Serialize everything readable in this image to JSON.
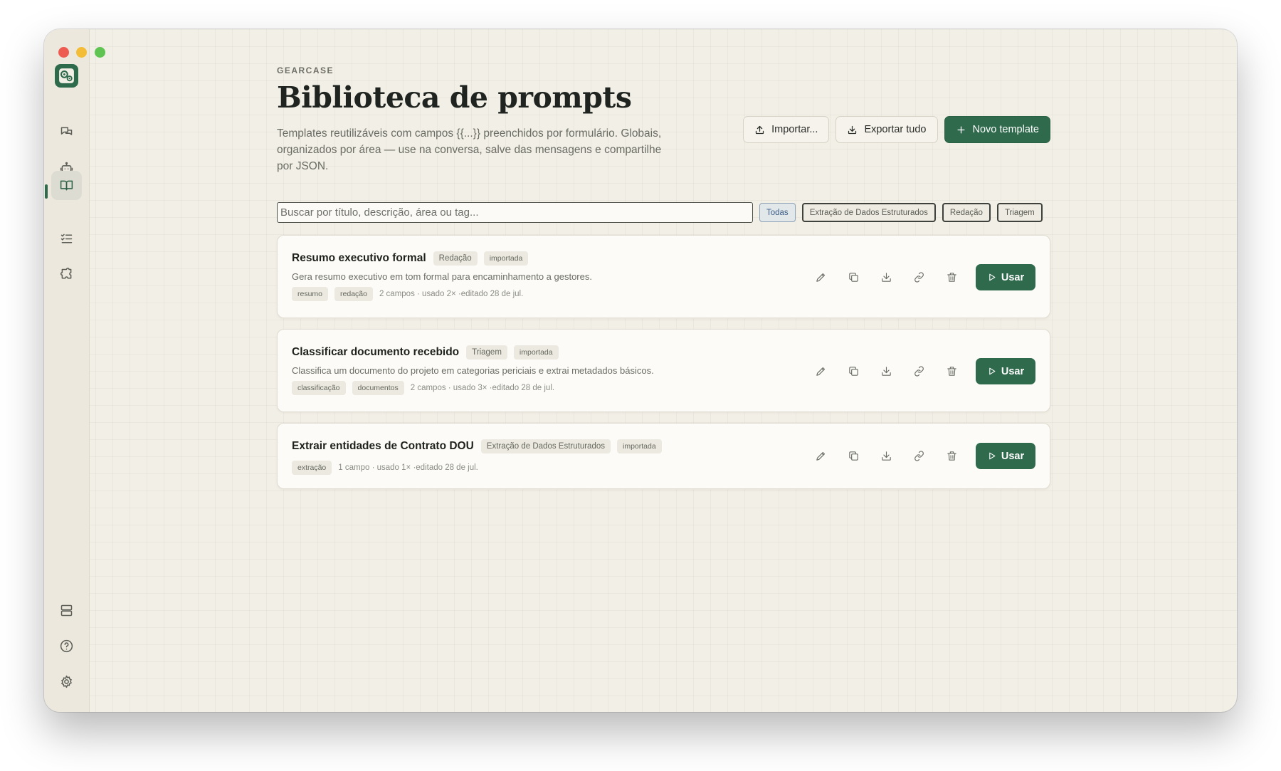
{
  "app": {
    "eyebrow": "GEARCASE",
    "title": "Biblioteca de prompts",
    "subtitle": "Templates reutilizáveis com campos {{...}} preenchidos por formulário. Globais, organizados por área — use na conversa, salve das mensagens e compartilhe por JSON.",
    "accent_color": "#2f6a4c"
  },
  "sidebar": {
    "items": [
      {
        "icon": "chat-icon"
      },
      {
        "icon": "robot-icon"
      },
      {
        "icon": "book-icon",
        "active": true
      },
      {
        "icon": "checklist-icon"
      },
      {
        "icon": "puzzle-icon"
      }
    ],
    "bottom_items": [
      {
        "icon": "server-icon"
      },
      {
        "icon": "help-icon"
      },
      {
        "icon": "settings-icon"
      }
    ]
  },
  "header_actions": {
    "import_label": "Importar...",
    "export_label": "Exportar tudo",
    "new_label": "Novo template"
  },
  "search": {
    "placeholder": "Buscar por título, descrição, área ou tag...",
    "value": ""
  },
  "filters": [
    {
      "label": "Todas",
      "active": true
    },
    {
      "label": "Extração de Dados Estruturados"
    },
    {
      "label": "Redação"
    },
    {
      "label": "Triagem"
    }
  ],
  "templates": [
    {
      "title": "Resumo executivo formal",
      "area": "Redação",
      "badge": "importada",
      "description": "Gera resumo executivo em tom formal para encaminhamento a gestores.",
      "tags": [
        "resumo",
        "redação"
      ],
      "meta": "2 campos · usado 2× ·editado 28 de jul.",
      "use_label": "Usar"
    },
    {
      "title": "Classificar documento recebido",
      "area": "Triagem",
      "badge": "importada",
      "description": "Classifica um documento do projeto em categorias periciais e extrai metadados básicos.",
      "tags": [
        "classificação",
        "documentos"
      ],
      "meta": "2 campos · usado 3× ·editado 28 de jul.",
      "use_label": "Usar"
    },
    {
      "title": "Extrair entidades de Contrato DOU",
      "area": "Extração de Dados Estruturados",
      "badge": "importada",
      "description": "",
      "tags": [
        "extração"
      ],
      "meta": "1 campo · usado 1× ·editado 28 de jul.",
      "use_label": "Usar"
    }
  ]
}
